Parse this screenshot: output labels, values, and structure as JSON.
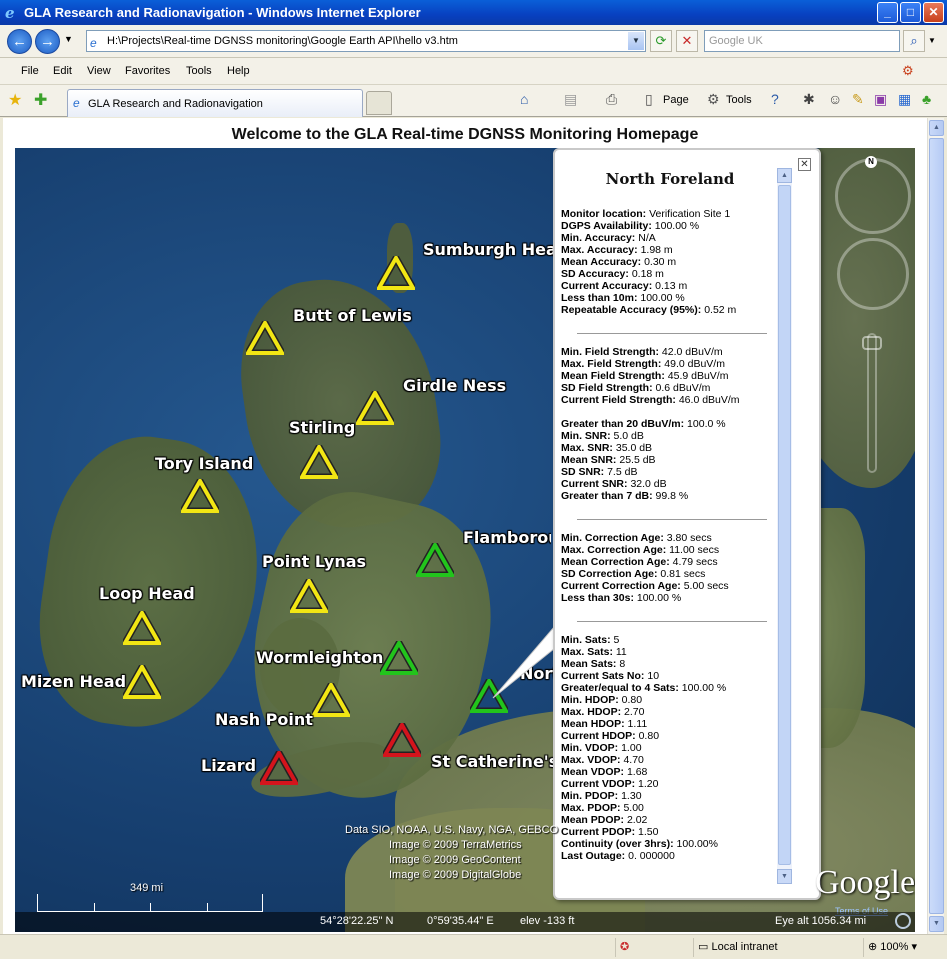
{
  "window": {
    "title": "GLA Research and Radionavigation - Windows Internet Explorer",
    "min_label": "_",
    "max_label": "□",
    "close_label": "✕"
  },
  "address": {
    "url": "H:\\Projects\\Real-time DGNSS monitoring\\Google Earth API\\hello v3.htm",
    "search_placeholder": "Google UK"
  },
  "menu": [
    "File",
    "Edit",
    "View",
    "Favorites",
    "Tools",
    "Help"
  ],
  "tab": {
    "label": "GLA Research and Radionavigation"
  },
  "commands": {
    "page_label": "Page",
    "tools_label": "Tools"
  },
  "page": {
    "heading": "Welcome to the GLA Real-time DGNSS Monitoring Homepage"
  },
  "sites": [
    {
      "name": "Sumburgh Head",
      "status": "yellow"
    },
    {
      "name": "Butt of Lewis",
      "status": "yellow"
    },
    {
      "name": "Girdle Ness",
      "status": "yellow"
    },
    {
      "name": "Stirling",
      "status": "yellow"
    },
    {
      "name": "Tory Island",
      "status": "yellow"
    },
    {
      "name": "Flamborough",
      "status": "green"
    },
    {
      "name": "Point Lynas",
      "status": "yellow"
    },
    {
      "name": "Loop Head",
      "status": "yellow"
    },
    {
      "name": "Wormleighton",
      "status": "green"
    },
    {
      "name": "North Foreland",
      "status": "green"
    },
    {
      "name": "Mizen Head",
      "status": "yellow"
    },
    {
      "name": "Nash Point",
      "status": "yellow"
    },
    {
      "name": "Lizard",
      "status": "red"
    },
    {
      "name": "St Catherine's",
      "status": "red"
    }
  ],
  "colors": {
    "yellow": "#f2e614",
    "green": "#22c41c",
    "red": "#d4141c"
  },
  "balloon": {
    "title": "North Foreland",
    "close_label": "✕",
    "group1": [
      {
        "k": "Monitor location:",
        "v": "Verification Site 1"
      },
      {
        "k": "DGPS Availability:",
        "v": "100.00 %"
      },
      {
        "k": "Min. Accuracy:",
        "v": "N/A"
      },
      {
        "k": "Max. Accuracy:",
        "v": "1.98 m"
      },
      {
        "k": "Mean Accuracy:",
        "v": "0.30 m"
      },
      {
        "k": "SD Accuracy:",
        "v": "0.18 m"
      },
      {
        "k": "Current Accuracy:",
        "v": "0.13 m"
      },
      {
        "k": "Less than 10m:",
        "v": "100.00 %"
      },
      {
        "k": "Repeatable Accuracy (95%):",
        "v": "0.52 m"
      }
    ],
    "group2a": [
      {
        "k": "Min. Field Strength:",
        "v": "42.0 dBuV/m"
      },
      {
        "k": "Max. Field Strength:",
        "v": "49.0 dBuV/m"
      },
      {
        "k": "Mean Field Strength:",
        "v": "45.9 dBuV/m"
      },
      {
        "k": "SD Field Strength:",
        "v": "0.6 dBuV/m"
      },
      {
        "k": "Current Field Strength:",
        "v": "46.0 dBuV/m"
      }
    ],
    "group2b": [
      {
        "k": "Greater than 20 dBuV/m:",
        "v": "100.0 %"
      },
      {
        "k": "Min. SNR:",
        "v": "5.0 dB"
      },
      {
        "k": "Max. SNR:",
        "v": "35.0 dB"
      },
      {
        "k": "Mean SNR:",
        "v": "25.5 dB"
      },
      {
        "k": "SD SNR:",
        "v": "7.5 dB"
      },
      {
        "k": "Current SNR:",
        "v": "32.0 dB"
      },
      {
        "k": "Greater than 7 dB:",
        "v": "99.8 %"
      }
    ],
    "group3": [
      {
        "k": "Min. Correction Age:",
        "v": "3.80 secs"
      },
      {
        "k": "Max. Correction Age:",
        "v": "11.00 secs"
      },
      {
        "k": "Mean Correction Age:",
        "v": "4.79 secs"
      },
      {
        "k": "SD Correction Age:",
        "v": "0.81 secs"
      },
      {
        "k": "Current Correction Age:",
        "v": "5.00 secs"
      },
      {
        "k": "Less than 30s:",
        "v": "100.00 %"
      }
    ],
    "group4": [
      {
        "k": "Min. Sats:",
        "v": "5"
      },
      {
        "k": "Max. Sats:",
        "v": "11"
      },
      {
        "k": "Mean Sats:",
        "v": "8"
      },
      {
        "k": "Current Sats No:",
        "v": "10"
      },
      {
        "k": "Greater/equal to 4 Sats:",
        "v": "100.00 %"
      },
      {
        "k": "Min. HDOP:",
        "v": "0.80"
      },
      {
        "k": "Max. HDOP:",
        "v": "2.70"
      },
      {
        "k": "Mean HDOP:",
        "v": "1.11"
      },
      {
        "k": "Current HDOP:",
        "v": "0.80"
      },
      {
        "k": "Min. VDOP:",
        "v": "1.00"
      },
      {
        "k": "Max. VDOP:",
        "v": "4.70"
      },
      {
        "k": "Mean VDOP:",
        "v": "1.68"
      },
      {
        "k": "Current VDOP:",
        "v": "1.20"
      },
      {
        "k": "Min. PDOP:",
        "v": "1.30"
      },
      {
        "k": "Max. PDOP:",
        "v": "5.00"
      },
      {
        "k": "Mean PDOP:",
        "v": "2.02"
      },
      {
        "k": "Current PDOP:",
        "v": "1.50"
      },
      {
        "k": "Continuity (over 3hrs):",
        "v": "100.00%"
      },
      {
        "k": "Last Outage:",
        "v": "0. 000000"
      }
    ]
  },
  "map": {
    "attribution": [
      "Data SIO, NOAA, U.S. Navy, NGA, GEBCO",
      "Image © 2009 TerraMetrics",
      "Image © 2009 GeoContent",
      "Image © 2009 DigitalGlobe"
    ],
    "scale": "349 mi",
    "lat": "54°28'22.25\" N",
    "lon": "0°59'35.44\" E",
    "elev": "elev  -133 ft",
    "eye_alt": "Eye alt  1056.34 mi",
    "logo": "Google",
    "terms": "Terms of Use",
    "north": "N"
  },
  "status": {
    "zone": "Local intranet",
    "zoom": "100%"
  }
}
